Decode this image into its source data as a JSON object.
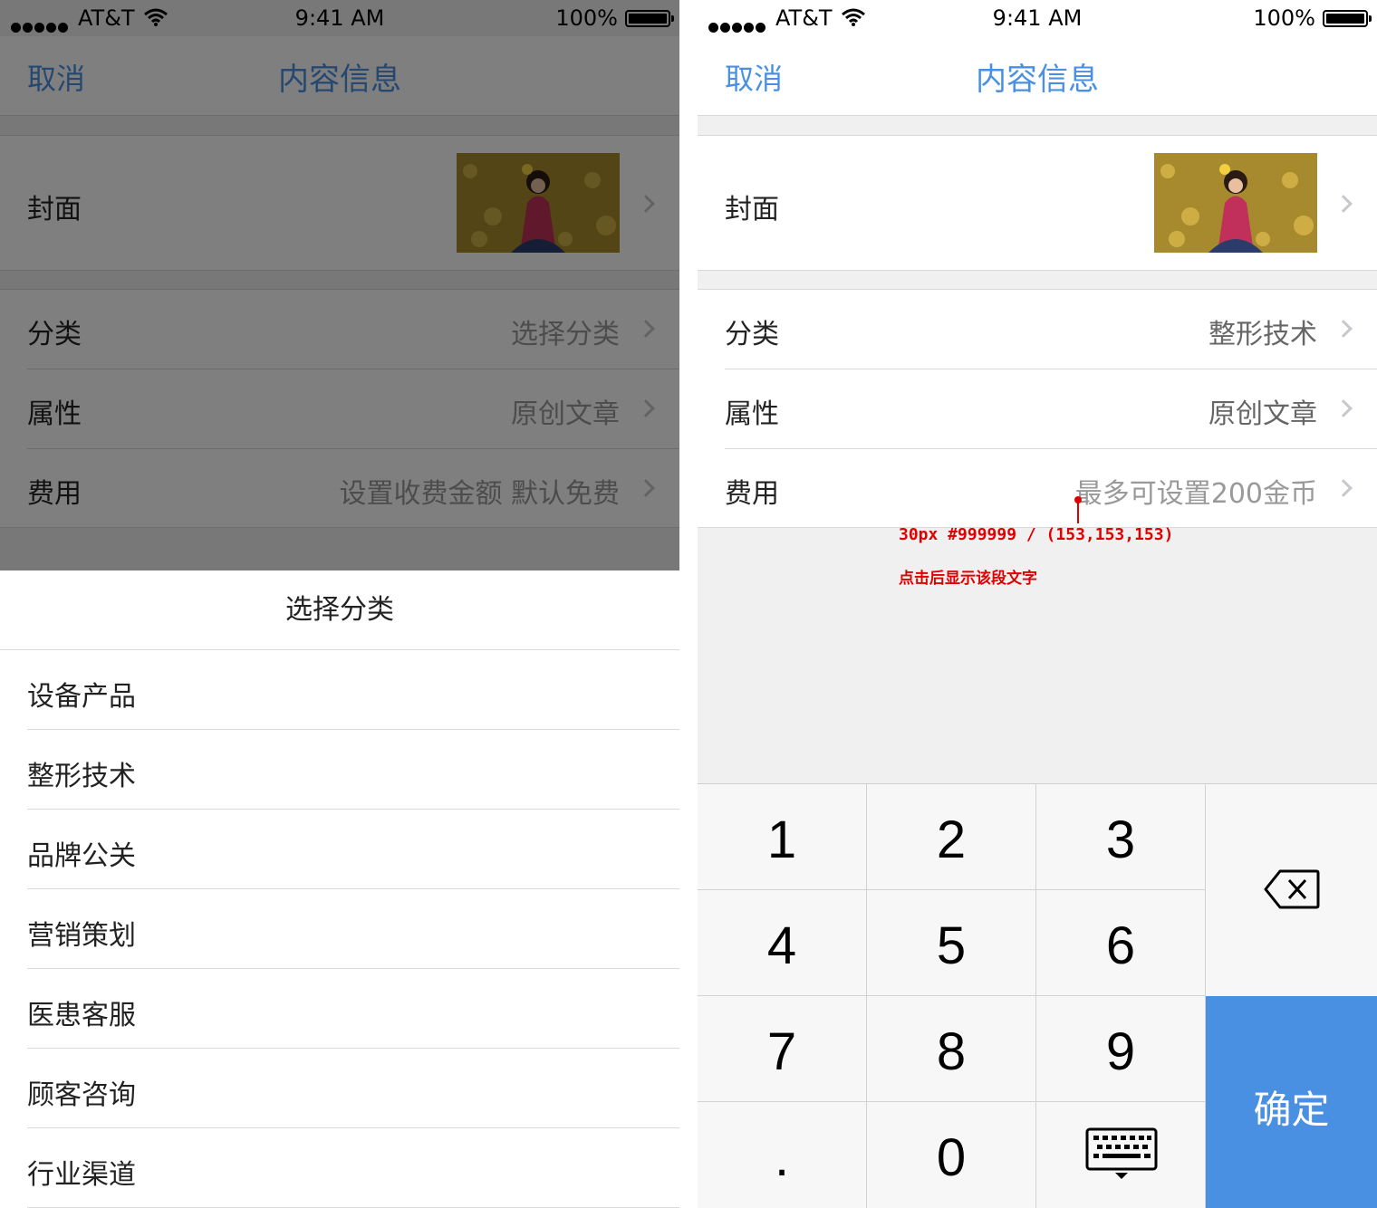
{
  "status_bar": {
    "carrier": "AT&T",
    "time": "9:41 AM",
    "battery": "100%"
  },
  "nav": {
    "cancel": "取消",
    "title": "内容信息"
  },
  "cover": {
    "label": "封面"
  },
  "left_form": {
    "category": {
      "label": "分类",
      "value": "选择分类"
    },
    "attribute": {
      "label": "属性",
      "value": "原创文章"
    },
    "fee": {
      "label": "费用",
      "value": "设置收费金额 默认免费"
    }
  },
  "sheet": {
    "title": "选择分类",
    "items": [
      "设备产品",
      "整形技术",
      "品牌公关",
      "营销策划",
      "医患客服",
      "顾客咨询",
      "行业渠道"
    ]
  },
  "right_form": {
    "category": {
      "label": "分类",
      "value": "整形技术"
    },
    "attribute": {
      "label": "属性",
      "value": "原创文章"
    },
    "fee": {
      "label": "费用",
      "value": "最多可设置200金币"
    }
  },
  "annotation": {
    "spec": "30px #999999 / (153,153,153)",
    "note": "点击后显示该段文字"
  },
  "keypad": {
    "keys": [
      "1",
      "2",
      "3",
      "4",
      "5",
      "6",
      "7",
      "8",
      "9",
      ".",
      "0"
    ],
    "confirm": "确定",
    "delete_icon": "backspace-icon",
    "dismiss_icon": "keyboard-dismiss-icon"
  },
  "colors": {
    "accent": "#4a90e2",
    "placeholder": "#999999",
    "annotation": "#e00000"
  }
}
